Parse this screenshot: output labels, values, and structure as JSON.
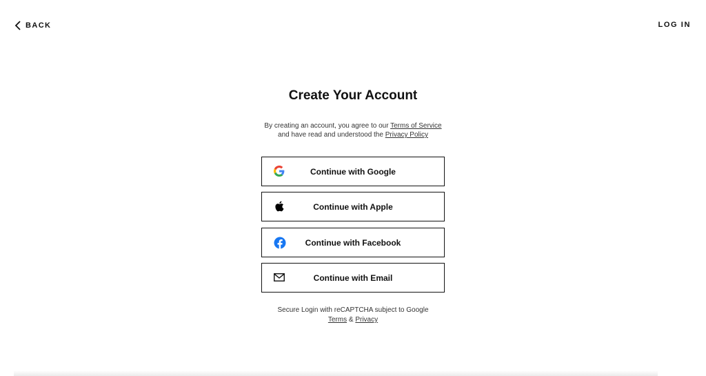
{
  "nav": {
    "back_label": "BACK",
    "login_label": "LOG IN"
  },
  "main": {
    "title": "Create Your Account",
    "legal": {
      "line1_prefix": "By creating an account, you agree to our ",
      "terms_link": "Terms of Service",
      "line2_prefix": "and have read and understood the ",
      "privacy_link": "Privacy Policy"
    },
    "buttons": [
      {
        "label": "Continue with Google",
        "icon": "google-icon"
      },
      {
        "label": "Continue with Apple",
        "icon": "apple-icon"
      },
      {
        "label": "Continue with Facebook",
        "icon": "facebook-icon"
      },
      {
        "label": "Continue with Email",
        "icon": "mail-icon"
      }
    ],
    "footer": {
      "line1": "Secure Login with reCAPTCHA subject to Google",
      "terms_link": "Terms",
      "separator": " & ",
      "privacy_link": "Privacy"
    }
  },
  "colors": {
    "facebook_blue": "#1877F2",
    "google_blue": "#4285F4",
    "google_red": "#EA4335",
    "google_yellow": "#FBBC05",
    "google_green": "#34A853"
  }
}
